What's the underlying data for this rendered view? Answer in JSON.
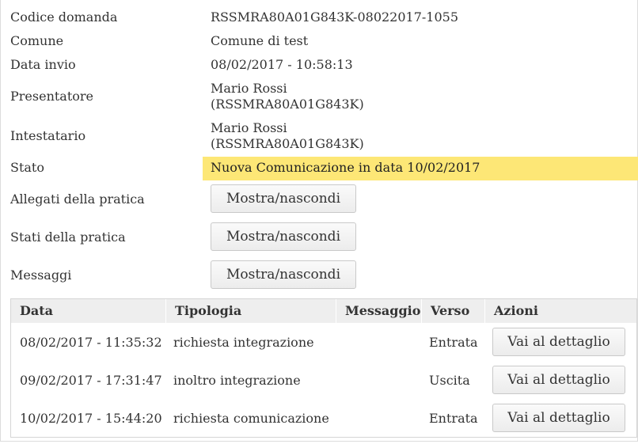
{
  "details": {
    "codice_label": "Codice domanda",
    "codice_value": "RSSMRA80A01G843K-08022017-1055",
    "comune_label": "Comune",
    "comune_value": "Comune di test",
    "data_label": "Data invio",
    "data_value": "08/02/2017 - 10:58:13",
    "presentatore_label": "Presentatore",
    "presentatore_name": "Mario Rossi",
    "presentatore_code": "(RSSMRA80A01G843K)",
    "intestatario_label": "Intestatario",
    "intestatario_name": "Mario Rossi",
    "intestatario_code": "(RSSMRA80A01G843K)",
    "stato_label": "Stato",
    "stato_value": "Nuova Comunicazione in data 10/02/2017",
    "stato_color": "#fde776"
  },
  "sections": {
    "allegati_label": "Allegati della pratica",
    "stati_label": "Stati della pratica",
    "messaggi_label": "Messaggi",
    "toggle_label": "Mostra/nascondi"
  },
  "table": {
    "headers": [
      "Data",
      "Tipologia",
      "Messaggio",
      "Verso",
      "Azioni"
    ],
    "rows": [
      {
        "data": "08/02/2017 - 11:35:32",
        "tipologia": "richiesta integrazione",
        "messaggio": "",
        "verso": "Entrata",
        "azione": "Vai al dettaglio"
      },
      {
        "data": "09/02/2017 - 17:31:47",
        "tipologia": "inoltro integrazione",
        "messaggio": "",
        "verso": "Uscita",
        "azione": "Vai al dettaglio"
      },
      {
        "data": "10/02/2017 - 15:44:20",
        "tipologia": "richiesta comunicazione",
        "messaggio": "",
        "verso": "Entrata",
        "azione": "Vai al dettaglio"
      }
    ]
  }
}
